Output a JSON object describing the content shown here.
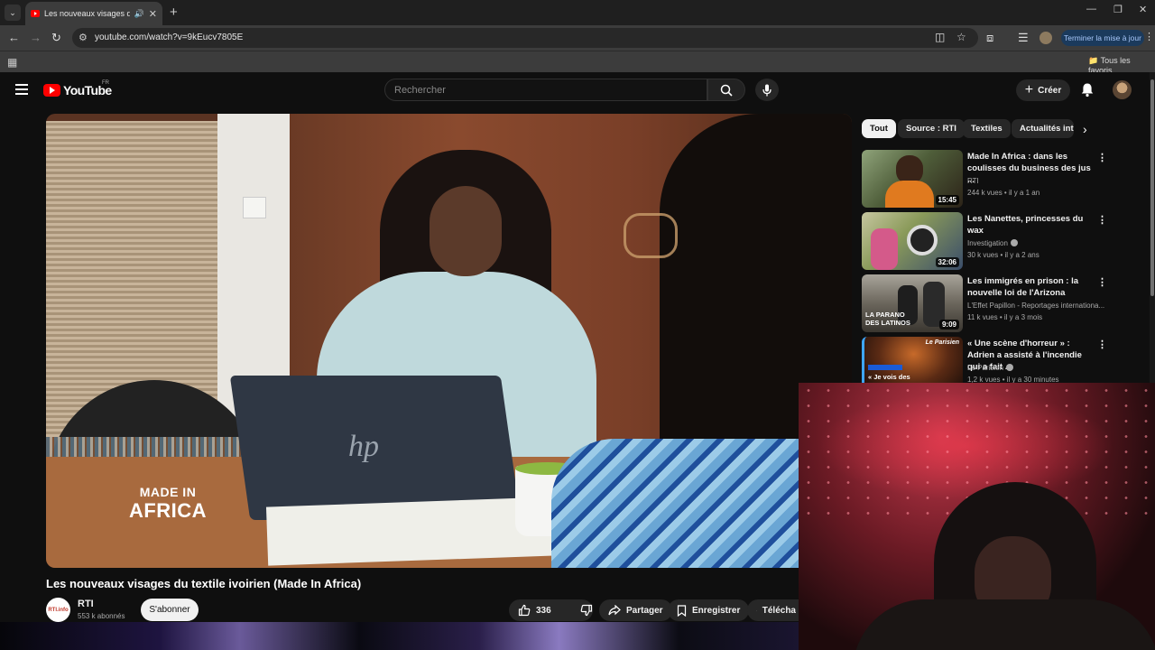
{
  "browser": {
    "tab_title": "Les nouveaux visages du te",
    "url": "youtube.com/watch?v=9kEucv7805E",
    "update_button": "Terminer la mise à jour",
    "bookmarks_label": "Tous les favoris"
  },
  "header": {
    "logo_text": "YouTube",
    "region": "FR",
    "search_placeholder": "Rechercher",
    "create_label": "Créer"
  },
  "video": {
    "overlay_line1": "MADE IN",
    "overlay_line2": "AFRICA",
    "title": "Les nouveaux visages du textile ivoirien (Made In Africa)",
    "channel_logo": "RTI.info",
    "channel": "RTI",
    "subscribers": "553 k abonnés",
    "subscribe_label": "S'abonner",
    "likes": "336",
    "share_label": "Partager",
    "save_label": "Enregistrer",
    "download_label": "Télécha"
  },
  "chips": [
    "Tout",
    "Source : RTI",
    "Textiles",
    "Actualités inte"
  ],
  "recommendations": [
    {
      "title": "Made In Africa : dans les coulisses du business des jus ...",
      "channel": "RTI",
      "meta": "244 k vues • il y a 1 an",
      "duration": "15:45",
      "verified": false,
      "thumb_color": "#6b7a52"
    },
    {
      "title": "Les Nanettes, princesses du wax",
      "channel": "Investigation",
      "meta": "30 k vues • il y a 2 ans",
      "duration": "32:06",
      "verified": true,
      "thumb_color": "#a9a27a"
    },
    {
      "title": "Les immigrés en prison : la nouvelle loi de l'Arizona",
      "channel": "L'Effet Papillon - Reportages internationa...",
      "meta": "11 k vues • il y a 3 mois",
      "duration": "9:09",
      "verified": false,
      "thumb_color": "#6d6a62",
      "thumb_text": "LA PARANO DES LATINOS"
    },
    {
      "title": "« Une scène d'horreur » : Adrien a assisté à l'incendie qui a fait ...",
      "channel": "Le Parisien",
      "meta": "1,2 k vues • il y a 30 minutes",
      "duration": "",
      "verified": true,
      "thumb_color": "#3a2418",
      "thumb_text": "« Je vois des",
      "thumb_brand": "Le Parisien"
    }
  ]
}
